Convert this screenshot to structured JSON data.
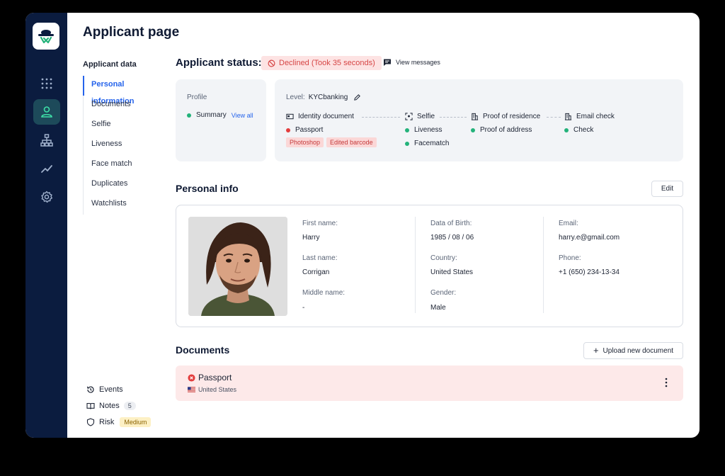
{
  "page": {
    "title": "Applicant page"
  },
  "subnav": {
    "heading": "Applicant data",
    "items": [
      {
        "label": "Personal information",
        "active": true
      },
      {
        "label": "Documents"
      },
      {
        "label": "Selfie"
      },
      {
        "label": "Liveness"
      },
      {
        "label": "Face match"
      },
      {
        "label": "Duplicates"
      },
      {
        "label": "Watchlists"
      }
    ]
  },
  "bottom_links": {
    "events": "Events",
    "notes": "Notes",
    "notes_count": "5",
    "risk": "Risk",
    "risk_level": "Medium"
  },
  "status": {
    "title": "Applicant status:",
    "badge": "Declined (Took 35 seconds)",
    "view_messages": "View messages"
  },
  "profile": {
    "heading": "Profile",
    "summary": "Summary",
    "view_all": "View all"
  },
  "level": {
    "label": "Level:",
    "value": "KYCbanking",
    "steps": [
      {
        "title": "Identity document",
        "items": [
          "Passport"
        ],
        "tags": [
          "Photoshop",
          "Edited barcode"
        ]
      },
      {
        "title": "Selfie",
        "items": [
          "Liveness",
          "Facematch"
        ]
      },
      {
        "title": "Proof of residence",
        "items": [
          "Proof of address"
        ]
      },
      {
        "title": "Email check",
        "items": [
          "Check"
        ]
      }
    ]
  },
  "personal_info": {
    "title": "Personal info",
    "edit": "Edit",
    "fields": {
      "first_name_label": "First name:",
      "first_name": "Harry",
      "last_name_label": "Last name:",
      "last_name": "Corrigan",
      "middle_name_label": "Middle name:",
      "middle_name": "-",
      "dob_label": "Data of Birth:",
      "dob": "1985 / 08 / 06",
      "country_label": "Country:",
      "country": "United States",
      "gender_label": "Gender:",
      "gender": "Male",
      "email_label": "Email:",
      "email": "harry.e@gmail.com",
      "phone_label": "Phone:",
      "phone": "+1 (650) 234-13-34"
    }
  },
  "documents": {
    "title": "Documents",
    "upload": "Upload new document",
    "items": [
      {
        "name": "Passport",
        "country": "United States"
      }
    ]
  },
  "colors": {
    "accent": "#2563eb",
    "rail": "#0b1c3f",
    "danger": "#e33d3d",
    "success": "#23b27a"
  }
}
